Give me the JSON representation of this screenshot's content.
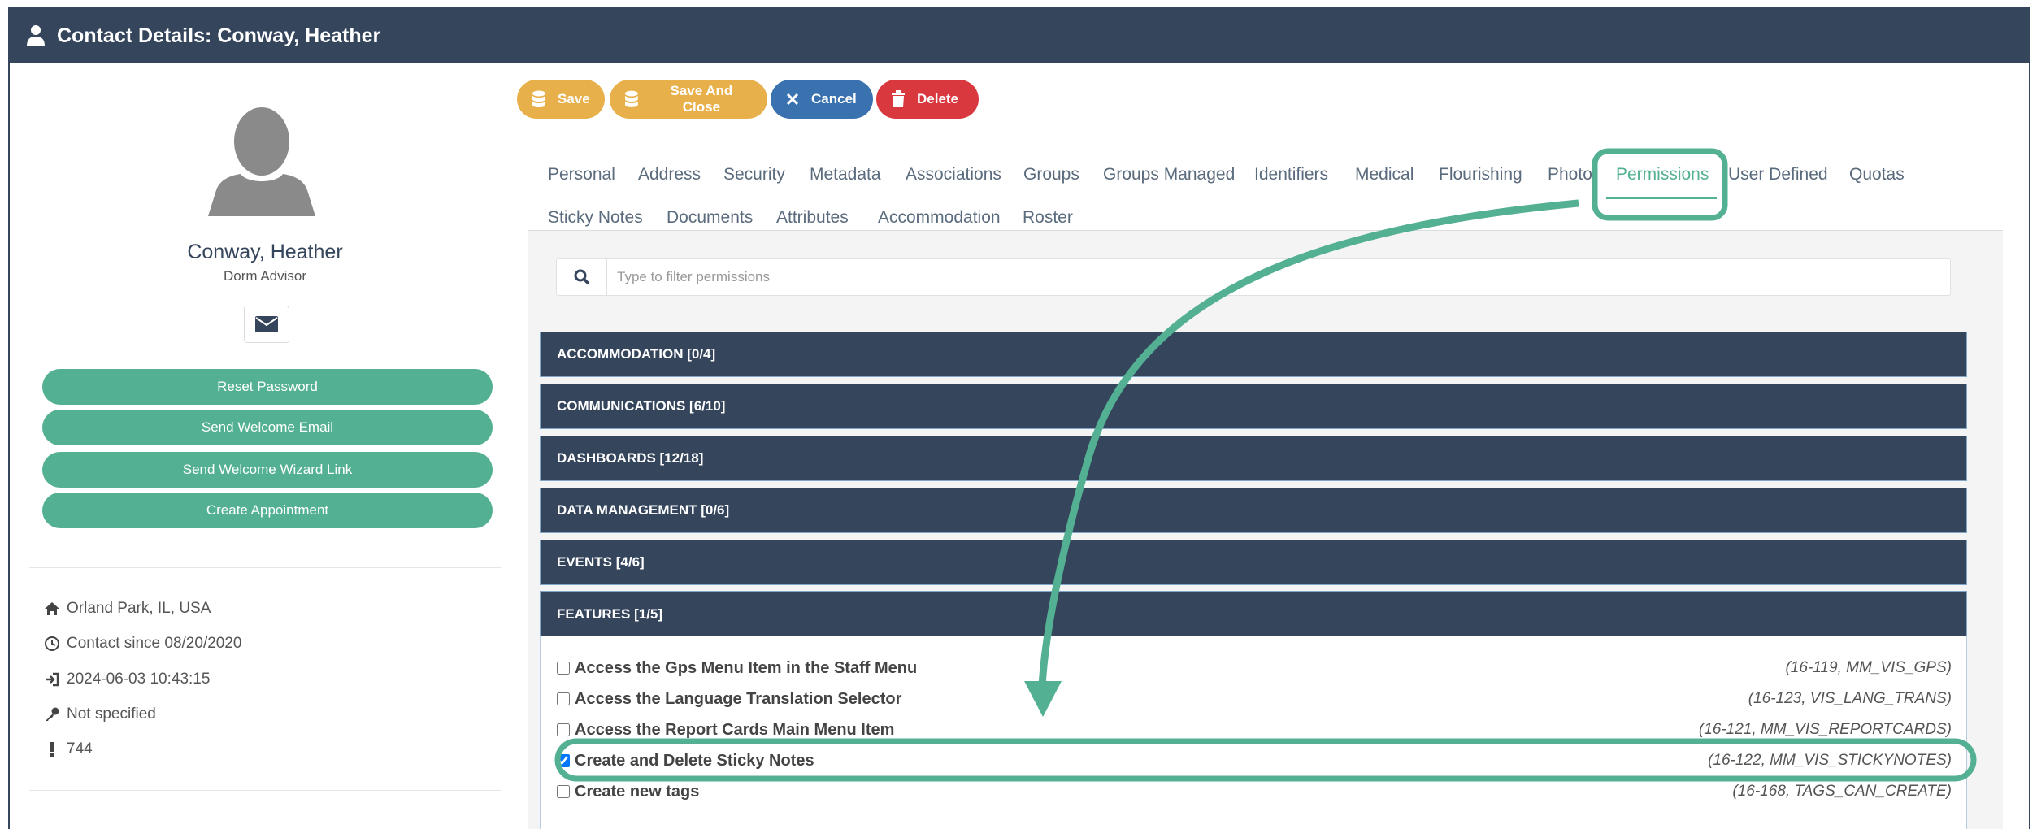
{
  "window": {
    "title": "Contact Details: Conway, Heather"
  },
  "profile": {
    "name": "Conway, Heather",
    "role": "Dorm Advisor",
    "buttons": [
      "Reset Password",
      "Send Welcome Email",
      "Send Welcome Wizard Link",
      "Create Appointment"
    ],
    "info": [
      {
        "icon": "home-icon",
        "text": "Orland Park, IL, USA"
      },
      {
        "icon": "clock-icon",
        "text": "Contact since 08/20/2020"
      },
      {
        "icon": "sign-in-icon",
        "text": "2024-06-03 10:43:15"
      },
      {
        "icon": "key-icon",
        "text": "Not specified"
      },
      {
        "icon": "exclamation-icon",
        "text": "744"
      }
    ]
  },
  "toolbar": {
    "save": "Save",
    "save_close": "Save And Close",
    "cancel": "Cancel",
    "delete": "Delete"
  },
  "tabs": {
    "row1": [
      "Personal",
      "Address",
      "Security",
      "Metadata",
      "Associations",
      "Groups",
      "Groups Managed",
      "Identifiers",
      "Medical",
      "Flourishing",
      "Photo",
      "Permissions",
      "User Defined",
      "Quotas"
    ],
    "row2": [
      "Sticky Notes",
      "Documents",
      "Attributes",
      "Accommodation",
      "Roster"
    ],
    "active": "Permissions"
  },
  "filter": {
    "placeholder": "Type to filter permissions"
  },
  "categories": [
    "ACCOMMODATION [0/4]",
    "COMMUNICATIONS [6/10]",
    "DASHBOARDS [12/18]",
    "DATA MANAGEMENT [0/6]",
    "EVENTS [4/6]",
    "FEATURES [1/5]"
  ],
  "permissions": [
    {
      "label": "Access the Gps Menu Item in the Staff Menu",
      "code": "(16-119, MM_VIS_GPS)",
      "checked": false
    },
    {
      "label": "Access the Language Translation Selector",
      "code": "(16-123, VIS_LANG_TRANS)",
      "checked": false
    },
    {
      "label": "Access the Report Cards Main Menu Item",
      "code": "(16-121, MM_VIS_REPORTCARDS)",
      "checked": false
    },
    {
      "label": "Create and Delete Sticky Notes",
      "code": "(16-122, MM_VIS_STICKYNOTES)",
      "checked": true
    },
    {
      "label": "Create new tags",
      "code": "(16-168, TAGS_CAN_CREATE)",
      "checked": false
    }
  ],
  "colors": {
    "header": "#34455c",
    "accent": "#53b092",
    "save": "#e8b04a",
    "cancel": "#3a72b0",
    "delete": "#d9383f"
  }
}
